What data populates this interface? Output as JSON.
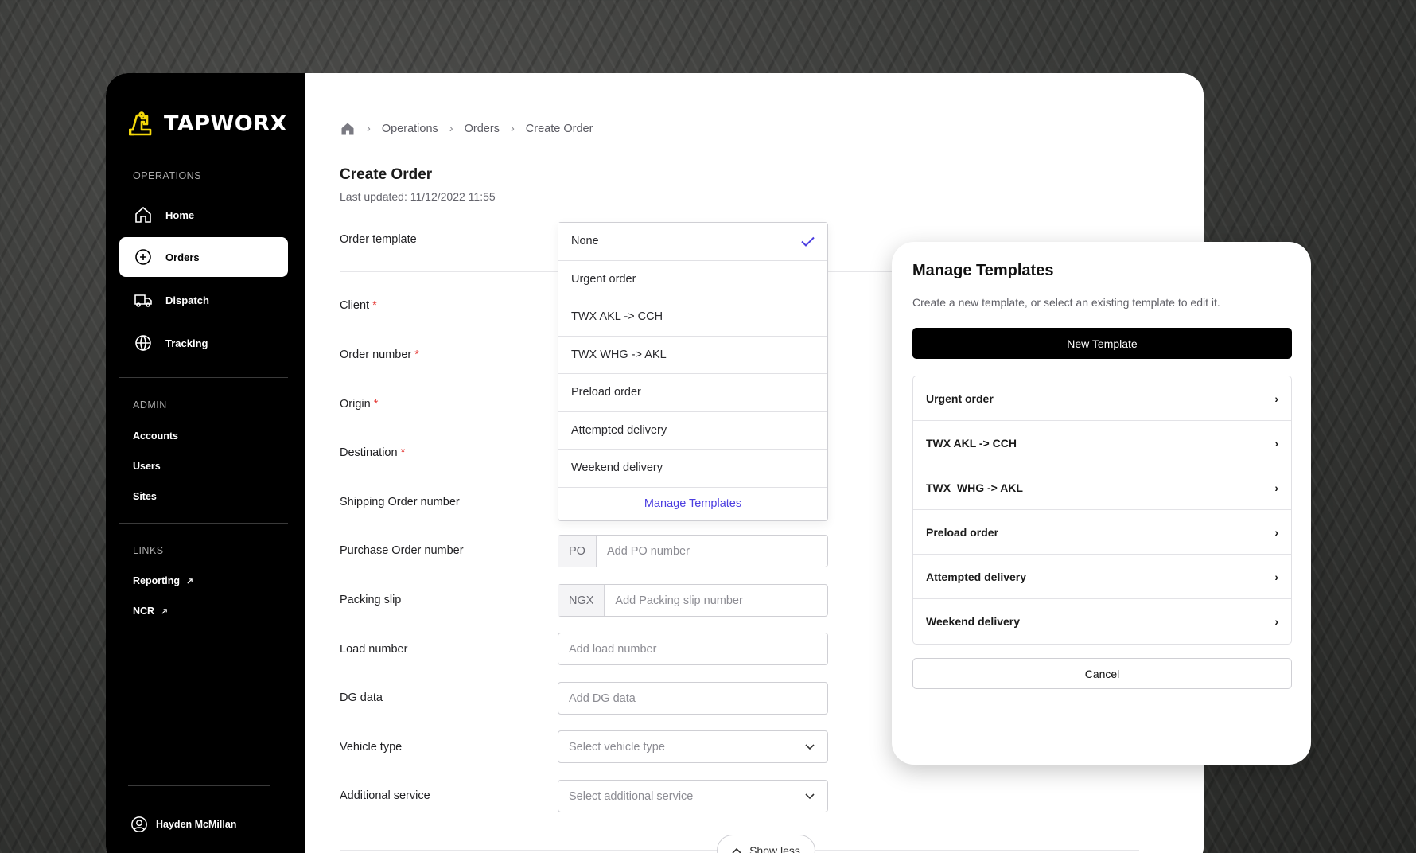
{
  "brand": {
    "name": "TAPWORX",
    "accent": "#f5d90a"
  },
  "sidebar": {
    "operations_label": "OPERATIONS",
    "operations": [
      {
        "label": "Home",
        "icon": "home-icon"
      },
      {
        "label": "Orders",
        "icon": "plus-circle-icon",
        "active": true
      },
      {
        "label": "Dispatch",
        "icon": "truck-icon"
      },
      {
        "label": "Tracking",
        "icon": "globe-icon"
      }
    ],
    "admin_label": "ADMIN",
    "admin": [
      {
        "label": "Accounts"
      },
      {
        "label": "Users"
      },
      {
        "label": "Sites"
      }
    ],
    "links_label": "LINKS",
    "links": [
      {
        "label": "Reporting",
        "icon": "external-link-icon"
      },
      {
        "label": "NCR",
        "icon": "external-link-icon"
      }
    ],
    "user": {
      "name": "Hayden McMillan",
      "icon": "user-circle-icon"
    }
  },
  "breadcrumb": {
    "items": [
      "Operations",
      "Orders",
      "Create Order"
    ]
  },
  "page": {
    "title": "Create Order",
    "updated": "Last updated: 11/12/2022 11:55"
  },
  "form": {
    "order_template": "Order template",
    "client": "Client",
    "order_number": "Order number",
    "origin": "Origin",
    "destination": "Destination",
    "shipping_order_number": "Shipping Order number",
    "purchase_order_number": "Purchase Order number",
    "packing_slip": "Packing slip",
    "load_number": "Load number",
    "dg_data": "DG data",
    "vehicle_type": "Vehicle type",
    "additional_service": "Additional service",
    "required_mark": "*",
    "po_prefix": "PO",
    "po_placeholder": "Add PO number",
    "packing_prefix": "NGX",
    "packing_placeholder": "Add Packing slip number",
    "load_placeholder": "Add load number",
    "dg_placeholder": "Add DG data",
    "vehicle_placeholder": "Select vehicle type",
    "service_placeholder": "Select additional service"
  },
  "template_dropdown": {
    "options": [
      "None",
      "Urgent order",
      "TWX AKL -> CCH",
      "TWX WHG -> AKL",
      "Preload order",
      "Attempted delivery",
      "Weekend delivery"
    ],
    "selected": "None",
    "manage_label": "Manage Templates",
    "check_color": "#4c3ee0"
  },
  "show_less": "Show less",
  "manage_panel": {
    "title": "Manage Templates",
    "description": "Create a new template, or select an existing template to edit it.",
    "new_button": "New Template",
    "templates": [
      "Urgent order",
      "TWX AKL -> CCH",
      "TWX  WHG -> AKL",
      "Preload order",
      "Attempted delivery",
      "Weekend delivery"
    ],
    "cancel_button": "Cancel"
  }
}
